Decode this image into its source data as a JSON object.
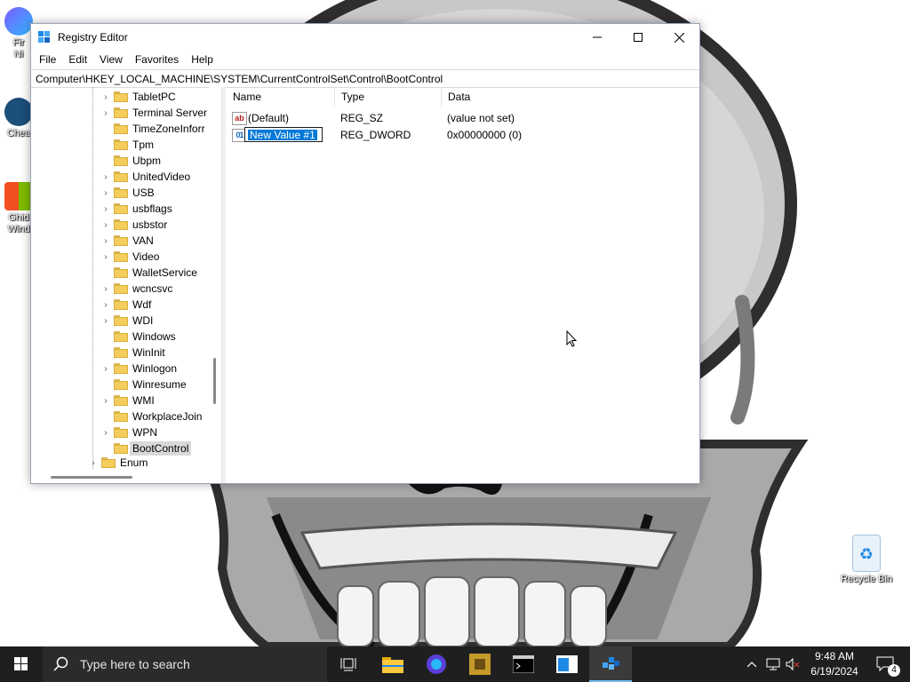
{
  "window": {
    "title": "Registry Editor",
    "menu": [
      "File",
      "Edit",
      "View",
      "Favorites",
      "Help"
    ],
    "address": "Computer\\HKEY_LOCAL_MACHINE\\SYSTEM\\CurrentControlSet\\Control\\BootControl"
  },
  "tree": {
    "items": [
      {
        "label": "TabletPC",
        "expandable": true
      },
      {
        "label": "Terminal Server",
        "expandable": true
      },
      {
        "label": "TimeZoneInforr",
        "expandable": false
      },
      {
        "label": "Tpm",
        "expandable": false
      },
      {
        "label": "Ubpm",
        "expandable": false
      },
      {
        "label": "UnitedVideo",
        "expandable": true
      },
      {
        "label": "USB",
        "expandable": true
      },
      {
        "label": "usbflags",
        "expandable": true
      },
      {
        "label": "usbstor",
        "expandable": true
      },
      {
        "label": "VAN",
        "expandable": true
      },
      {
        "label": "Video",
        "expandable": true
      },
      {
        "label": "WalletService",
        "expandable": false
      },
      {
        "label": "wcncsvc",
        "expandable": true
      },
      {
        "label": "Wdf",
        "expandable": true
      },
      {
        "label": "WDI",
        "expandable": true
      },
      {
        "label": "Windows",
        "expandable": false
      },
      {
        "label": "WinInit",
        "expandable": false
      },
      {
        "label": "Winlogon",
        "expandable": true
      },
      {
        "label": "Winresume",
        "expandable": false
      },
      {
        "label": "WMI",
        "expandable": true
      },
      {
        "label": "WorkplaceJoin",
        "expandable": false
      },
      {
        "label": "WPN",
        "expandable": true
      },
      {
        "label": "BootControl",
        "expandable": false,
        "selected": true
      }
    ],
    "partial_item": "Enum"
  },
  "list": {
    "columns": [
      "Name",
      "Type",
      "Data"
    ],
    "rows": [
      {
        "name": "(Default)",
        "type": "REG_SZ",
        "data": "(value not set)",
        "icon": "string-value-icon"
      },
      {
        "name": "New Value #1",
        "type": "REG_DWORD",
        "data": "0x00000000 (0)",
        "icon": "binary-value-icon",
        "editing": true
      }
    ]
  },
  "taskbar": {
    "search_placeholder": "Type here to search",
    "time": "9:48 AM",
    "date": "6/19/2024",
    "notification_count": "4"
  },
  "desktop_icons": [
    {
      "label": "Fir\nNi"
    },
    {
      "label": "Chea"
    },
    {
      "label": "Ghid\nWind"
    },
    {
      "label": "Recycle Bin"
    }
  ],
  "colors": {
    "selection": "#0078d7",
    "taskbar": "#1f1f1f",
    "folder": "#f5cd5c"
  }
}
